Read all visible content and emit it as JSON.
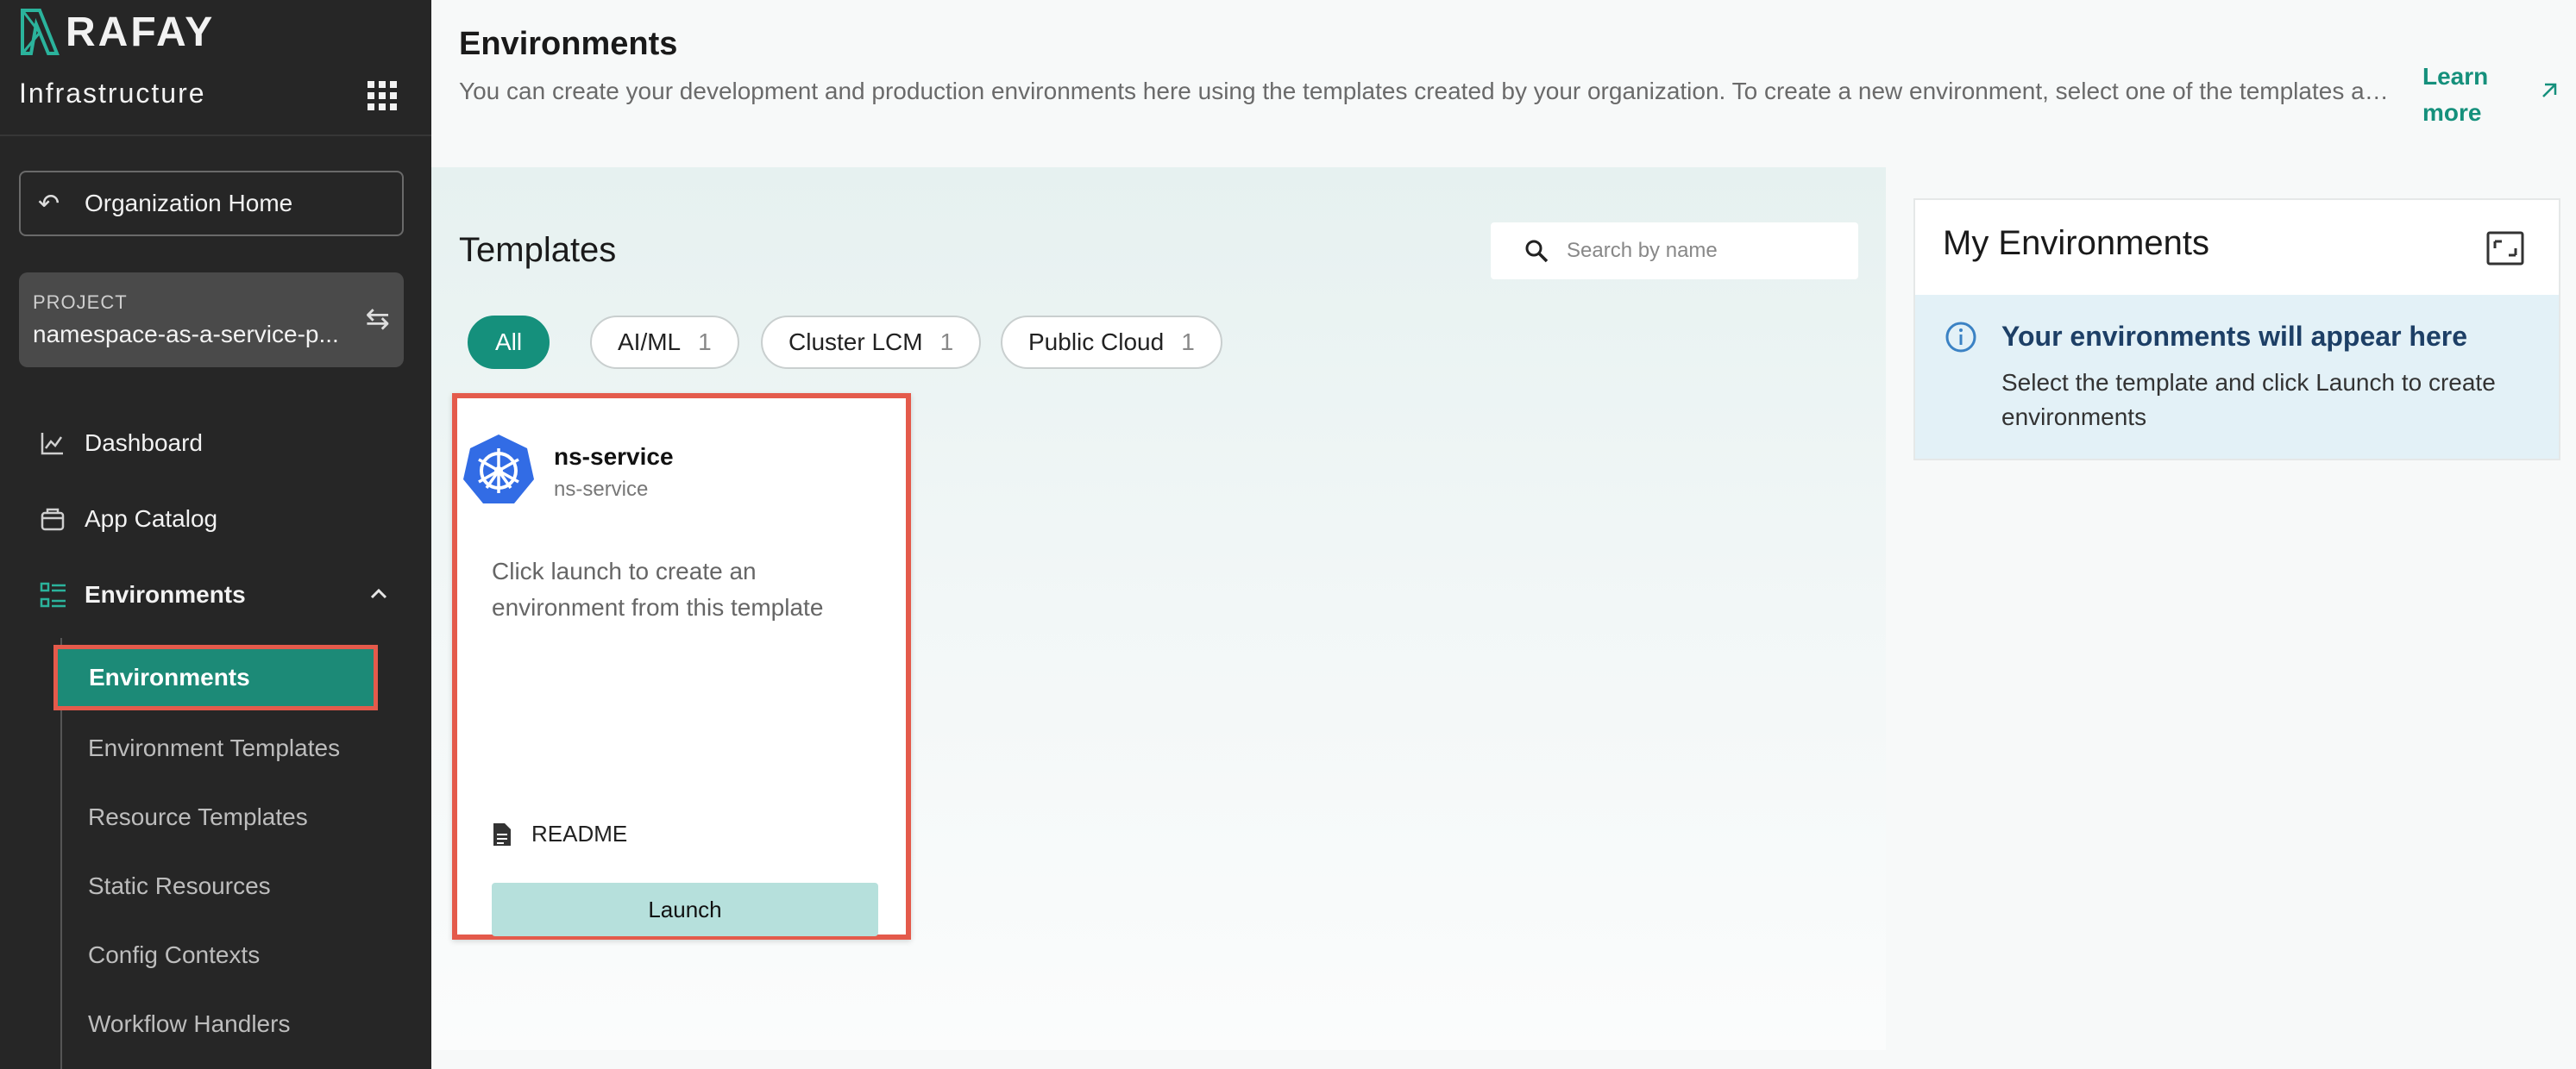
{
  "sidebar": {
    "brand": "RAFAY",
    "product": "Infrastructure",
    "org_home": "Organization Home",
    "project_label": "PROJECT",
    "project_name": "namespace-as-a-service-p...",
    "nav": {
      "dashboard": "Dashboard",
      "app_catalog": "App Catalog",
      "environments": "Environments"
    },
    "sub_items": {
      "environments": "Environments",
      "environment_templates": "Environment Templates",
      "resource_templates": "Resource Templates",
      "static_resources": "Static Resources",
      "config_contexts": "Config Contexts",
      "workflow_handlers": "Workflow Handlers"
    }
  },
  "header": {
    "title": "Environments",
    "description": "You can create your development and production environments here using the templates created by your organization. To create a new environment, select one of the templates and ...",
    "learn_more": "Learn more"
  },
  "templates": {
    "title": "Templates",
    "search_placeholder": "Search by name",
    "filters": [
      {
        "label": "All",
        "count": ""
      },
      {
        "label": "AI/ML",
        "count": "1"
      },
      {
        "label": "Cluster LCM",
        "count": "1"
      },
      {
        "label": "Public Cloud",
        "count": "1"
      }
    ],
    "card": {
      "name": "ns-service",
      "subtitle": "ns-service",
      "description": "Click launch to create an environment from this template",
      "readme": "README",
      "launch": "Launch"
    }
  },
  "my_environments": {
    "title": "My Environments",
    "info_title": "Your environments will appear here",
    "info_message": "Select the template and click Launch to create environments"
  },
  "colors": {
    "accent": "#15907c",
    "highlight": "#e45a4b",
    "sidebar_bg": "#262626",
    "info_bg": "#e3f1f7"
  }
}
